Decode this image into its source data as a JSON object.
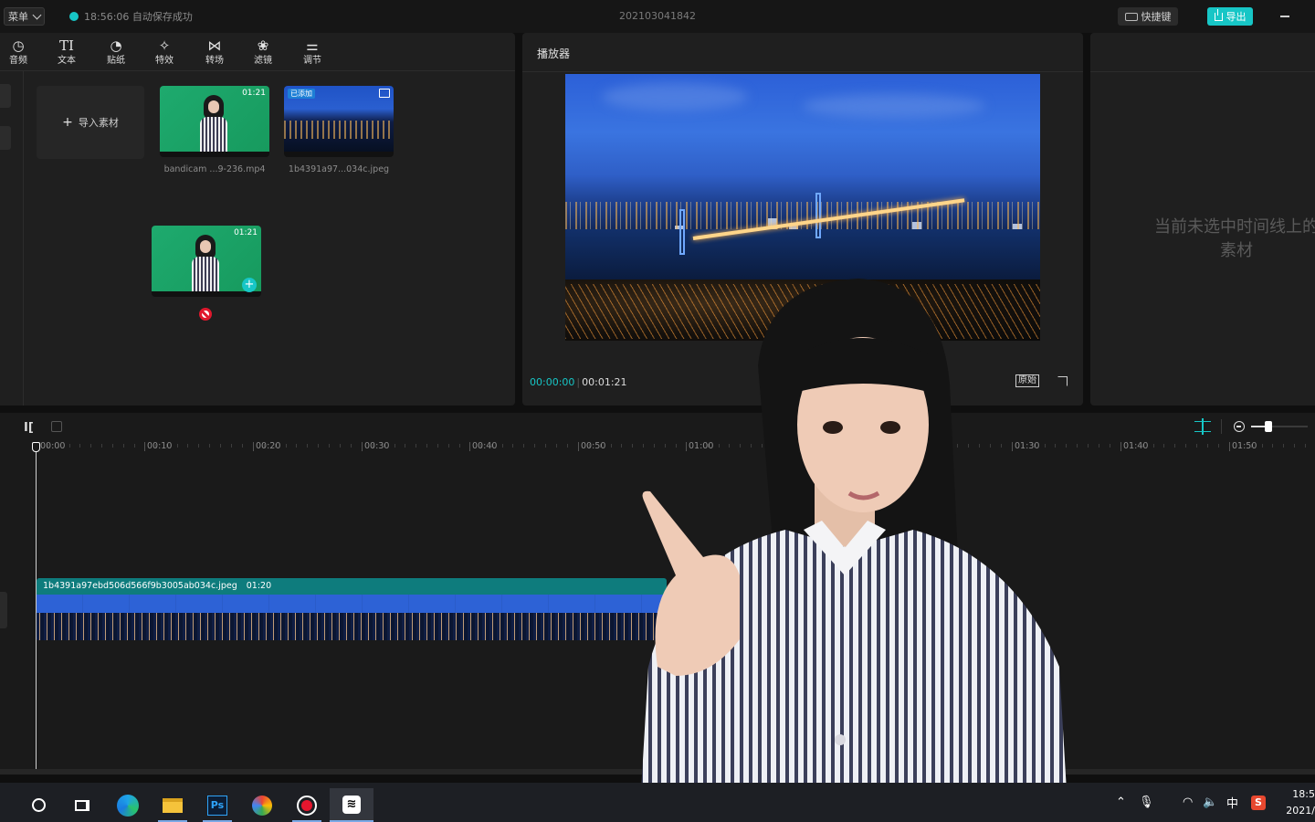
{
  "titlebar": {
    "menu_label": "菜单",
    "autosave_text": "18:56:06 自动保存成功",
    "project_title": "202103041842",
    "shortcut_label": "快捷键",
    "export_label": "导出"
  },
  "toolbar": {
    "items": [
      {
        "label": "音频",
        "icon": "audio-icon"
      },
      {
        "label": "文本",
        "icon": "text-icon"
      },
      {
        "label": "贴纸",
        "icon": "sticker-icon"
      },
      {
        "label": "特效",
        "icon": "effects-icon"
      },
      {
        "label": "转场",
        "icon": "transition-icon"
      },
      {
        "label": "滤镜",
        "icon": "filter-icon"
      },
      {
        "label": "调节",
        "icon": "adjust-icon"
      }
    ]
  },
  "media": {
    "import_label": "导入素材",
    "items": [
      {
        "name": "bandicam ...9-236.mp4",
        "duration": "01:21",
        "kind": "video"
      },
      {
        "name": "1b4391a97...034c.jpeg",
        "badge": "已添加",
        "kind": "image"
      }
    ],
    "drag_ghost_duration": "01:21"
  },
  "player": {
    "title": "播放器",
    "current_time": "00:00:00",
    "total_time": "00:01:21",
    "ratio_label": "原始"
  },
  "attributes": {
    "empty_message": "当前未选中时间线上的素材"
  },
  "timeline": {
    "ruler_labels": [
      "00:00",
      "00:10",
      "00:20",
      "00:30",
      "00:40",
      "00:50",
      "01:00",
      "01:30",
      "01:40",
      "01:50"
    ],
    "zoom_level": 0.3,
    "clip": {
      "name": "1b4391a97ebd506d566f9b3005ab034c.jpeg",
      "duration": "01:20"
    }
  },
  "taskbar": {
    "apps": [
      "cortana-icon",
      "task-view-icon",
      "edge-icon",
      "file-explorer-icon",
      "photoshop-icon",
      "color-app-icon",
      "recorder-icon",
      "capcut-icon"
    ],
    "photoshop_label": "Ps",
    "ime_label": "中",
    "clock_time": "18:5",
    "clock_date": "2021/"
  },
  "colors": {
    "accent": "#17c6c6",
    "clip_header": "#0e7c7d",
    "panel_bg": "#1f1f1f"
  }
}
